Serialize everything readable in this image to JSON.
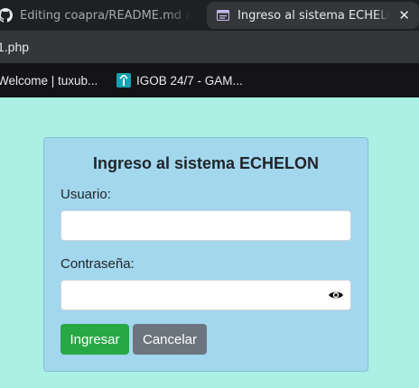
{
  "browser": {
    "tabs": [
      {
        "title": "Editing coapra/README.md at master",
        "icon": "github-icon",
        "active": false
      },
      {
        "title": "Ingreso al sistema ECHELON",
        "icon": "page-icon",
        "active": true
      }
    ],
    "url": "1.php",
    "bookmarks": [
      {
        "label": "Welcome | tuxub..."
      },
      {
        "label": "IGOB 24/7 - GAM..."
      }
    ]
  },
  "login": {
    "title": "Ingreso al sistema ECHELON",
    "user_label": "Usuario:",
    "user_value": "",
    "password_label": "Contraseña:",
    "password_value": "",
    "submit_label": "Ingresar",
    "cancel_label": "Cancelar"
  },
  "colors": {
    "page_bg": "#aaf0e4",
    "card_bg": "#a2d7ee",
    "submit": "#28a745",
    "cancel": "#6c757d"
  }
}
